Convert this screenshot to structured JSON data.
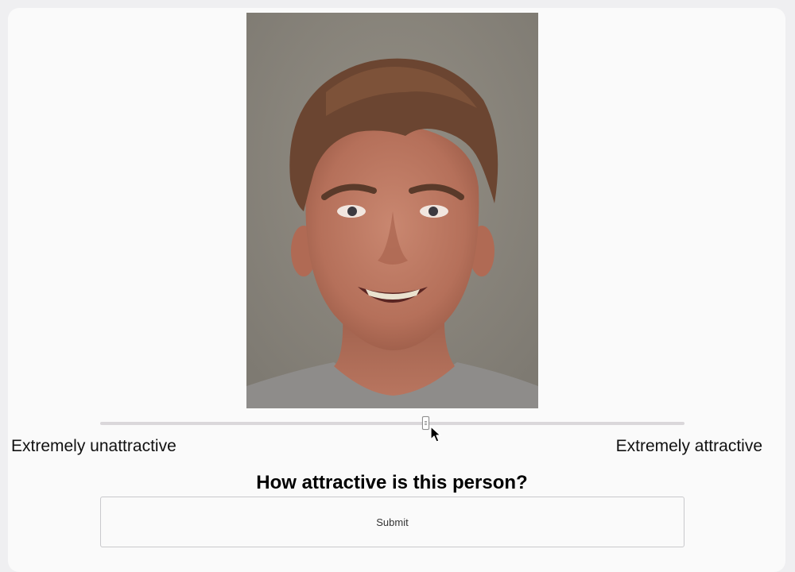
{
  "photo": {
    "subject": "portrait of a smiling young man with light brown hair on a grey background"
  },
  "rating": {
    "slider_value_fraction": 0.556,
    "min_label": "Extremely unattractive",
    "max_label": "Extremely attractive"
  },
  "question": "How attractive is this person?",
  "submit_label": "Submit",
  "colors": {
    "page_background": "#efeff1",
    "card_background": "#fafafa",
    "slider_track": "#dad7da",
    "photo_background": "#8a857c"
  }
}
